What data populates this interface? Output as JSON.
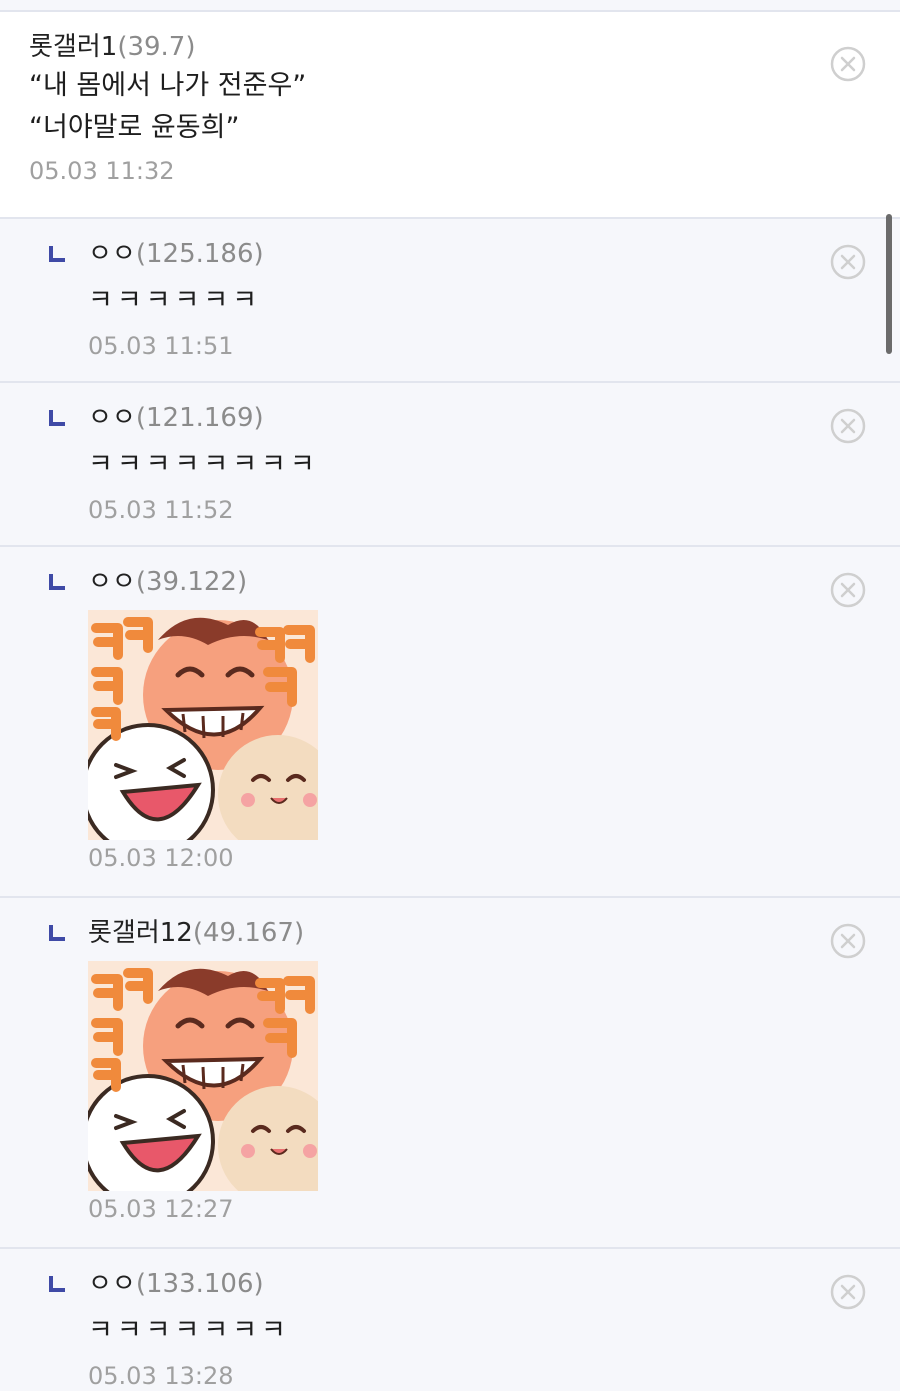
{
  "comments": [
    {
      "author": "롯갤러1",
      "ip": "(39.7)",
      "lines": [
        "“내 몸에서 나가 전준우”",
        "“너야말로 윤동희”"
      ],
      "time": "05.03 11:32"
    },
    {
      "author": "ㅇㅇ",
      "ip": "(125.186)",
      "text": "ㅋㅋㅋㅋㅋㅋ",
      "time": "05.03 11:51"
    },
    {
      "author": "ㅇㅇ",
      "ip": "(121.169)",
      "text": "ㅋㅋㅋㅋㅋㅋㅋㅋ",
      "time": "05.03 11:52"
    },
    {
      "author": "ㅇㅇ",
      "ip": "(39.122)",
      "sticker": "laughing-characters-sticker",
      "time": "05.03 12:00"
    },
    {
      "author": "롯갤러12",
      "ip": "(49.167)",
      "sticker": "laughing-characters-sticker",
      "time": "05.03 12:27"
    },
    {
      "author": "ㅇㅇ",
      "ip": "(133.106)",
      "text": "ㅋㅋㅋㅋㅋㅋㅋ",
      "time": "05.03 13:28"
    }
  ],
  "icons": {
    "reply": "reply-corner-icon",
    "delete": "circle-x-icon"
  },
  "colors": {
    "reply_mark": "#3f4aa6",
    "ip_text": "#8b8b8b",
    "timestamp": "#a0a0a0",
    "reply_background": "#f6f7fb",
    "main_background": "#ffffff"
  }
}
